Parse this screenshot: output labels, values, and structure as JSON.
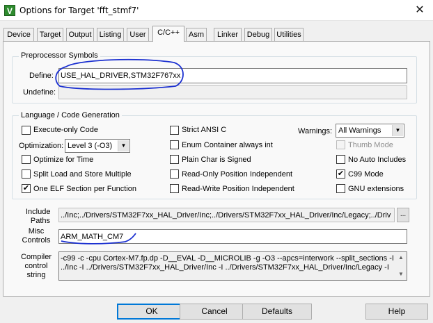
{
  "window": {
    "app_icon_letter": "V",
    "title": "Options for Target 'fft_stmf7'",
    "close_glyph": "✕"
  },
  "tabs": [
    {
      "label": "Device"
    },
    {
      "label": "Target"
    },
    {
      "label": "Output"
    },
    {
      "label": "Listing"
    },
    {
      "label": "User"
    },
    {
      "label": "C/C++",
      "active": true
    },
    {
      "label": "Asm"
    },
    {
      "label": "Linker"
    },
    {
      "label": "Debug"
    },
    {
      "label": "Utilities"
    }
  ],
  "preprocessor": {
    "title": "Preprocessor Symbols",
    "define_label": "Define:",
    "define_value": "USE_HAL_DRIVER,STM32F767xx",
    "undefine_label": "Undefine:",
    "undefine_value": ""
  },
  "language": {
    "title": "Language / Code Generation",
    "execute_only": {
      "label": "Execute-only Code",
      "checked": false
    },
    "optimization_label": "Optimization:",
    "optimization_value": "Level 3 (-O3)",
    "optimize_time": {
      "label": "Optimize for Time",
      "checked": false
    },
    "split_load": {
      "label": "Split Load and Store Multiple",
      "checked": false
    },
    "one_elf": {
      "label": "One ELF Section per Function",
      "checked": true
    },
    "strict_ansi": {
      "label": "Strict ANSI C",
      "checked": false
    },
    "enum_container": {
      "label": "Enum Container always int",
      "checked": false
    },
    "plain_char": {
      "label": "Plain Char is Signed",
      "checked": false
    },
    "ro_position": {
      "label": "Read-Only Position Independent",
      "checked": false
    },
    "rw_position": {
      "label": "Read-Write Position Independent",
      "checked": false
    },
    "warnings_label": "Warnings:",
    "warnings_value": "All Warnings",
    "thumb_mode": {
      "label": "Thumb Mode",
      "checked": false,
      "disabled": true
    },
    "no_auto_includes": {
      "label": "No Auto Includes",
      "checked": false
    },
    "c99_mode": {
      "label": "C99 Mode",
      "checked": true
    },
    "gnu_extensions": {
      "label": "GNU extensions",
      "checked": false
    }
  },
  "include": {
    "label_line1": "Include",
    "label_line2": "Paths",
    "value": "../Inc;../Drivers/STM32F7xx_HAL_Driver/Inc;../Drivers/STM32F7xx_HAL_Driver/Inc/Legacy;../Driv",
    "browse_label": "..."
  },
  "misc": {
    "label_line1": "Misc",
    "label_line2": "Controls",
    "value": "ARM_MATH_CM7"
  },
  "compiler": {
    "label_line1": "Compiler",
    "label_line2": "control",
    "label_line3": "string",
    "line1": "-c99 -c -cpu Cortex-M7.fp.dp -D__EVAL -D__MICROLIB -g -O3 --apcs=interwork --split_sections -I",
    "line2": "../Inc -I ../Drivers/STM32F7xx_HAL_Driver/Inc -I ../Drivers/STM32F7xx_HAL_Driver/Inc/Legacy -I"
  },
  "buttons": {
    "ok": "OK",
    "cancel": "Cancel",
    "defaults": "Defaults",
    "help": "Help"
  },
  "colors": {
    "annotation_ink": "#1a2fd0",
    "dialog_bg": "#f0f0f0",
    "panel_bg": "#f9f9f9"
  }
}
